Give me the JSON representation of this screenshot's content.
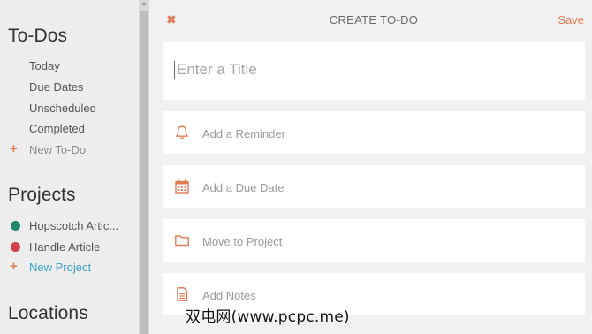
{
  "sidebar": {
    "todos_title": "To-Dos",
    "todos_items": [
      {
        "label": "Today"
      },
      {
        "label": "Due Dates"
      },
      {
        "label": "Unscheduled"
      },
      {
        "label": "Completed"
      }
    ],
    "new_todo_label": "New To-Do",
    "projects_title": "Projects",
    "projects": [
      {
        "label": "Hopscotch Artic...",
        "color": "#1f8a6b"
      },
      {
        "label": "Handle Article",
        "color": "#d2414b"
      }
    ],
    "new_project_label": "New Project",
    "locations_title": "Locations"
  },
  "header": {
    "title": "CREATE TO-DO",
    "save_label": "Save"
  },
  "form": {
    "title_placeholder": "Enter a Title",
    "reminder_label": "Add a Reminder",
    "due_date_label": "Add a Due Date",
    "project_label": "Move to Project",
    "notes_label": "Add Notes"
  },
  "watermark": "双电网(www.pcpc.me)",
  "colors": {
    "accent": "#e07a52",
    "link": "#3aa3c9",
    "sidebar_bg": "#ededed",
    "main_bg": "#f1f1f1"
  },
  "icons": {
    "close": "close-icon",
    "reminder": "bell-icon",
    "due_date": "calendar-icon",
    "project": "folder-icon",
    "notes": "note-icon",
    "add": "plus-icon"
  }
}
